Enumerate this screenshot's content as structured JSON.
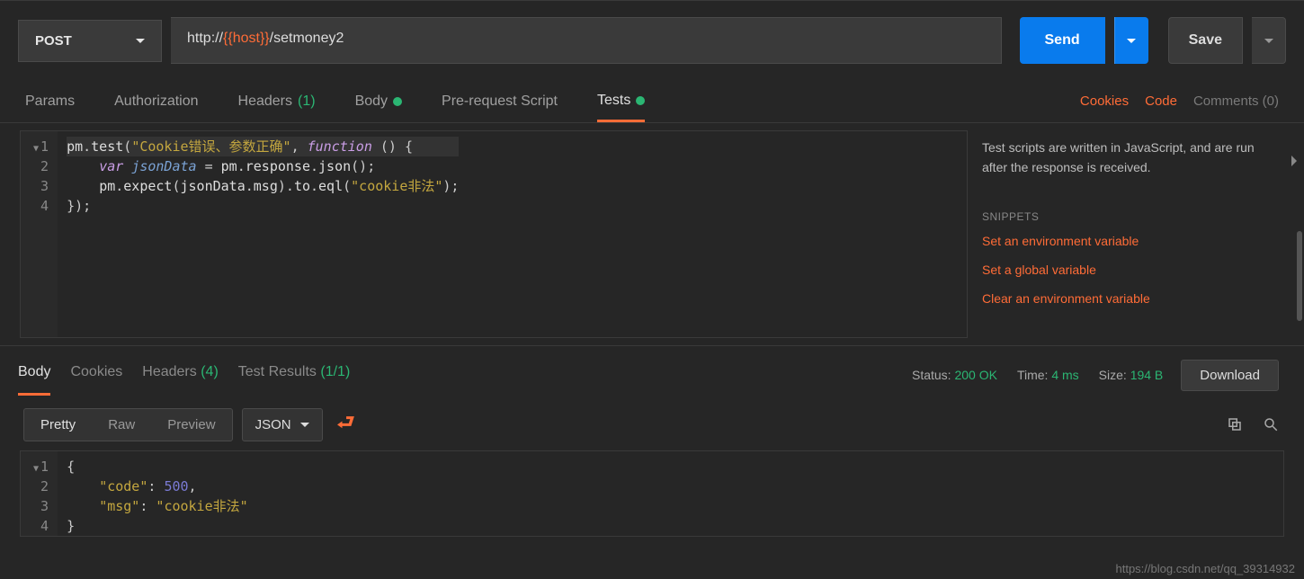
{
  "request": {
    "method": "POST",
    "url_prefix": "http://",
    "url_var": "{{host}}",
    "url_suffix": "/setmoney2",
    "send_label": "Send",
    "save_label": "Save"
  },
  "req_tabs": {
    "params": "Params",
    "authorization": "Authorization",
    "headers": "Headers",
    "headers_count": "(1)",
    "body": "Body",
    "prerequest": "Pre-request Script",
    "tests": "Tests"
  },
  "right_links": {
    "cookies": "Cookies",
    "code": "Code",
    "comments": "Comments (0)"
  },
  "test_script": {
    "lines": [
      "pm.test(\"Cookie错误、参数正确\", function () {",
      "    var jsonData = pm.response.json();",
      "    pm.expect(jsonData.msg).to.eql(\"cookie非法\");",
      "});"
    ]
  },
  "side": {
    "description": "Test scripts are written in JavaScript, and are run after the response is received.",
    "snippets_header": "SNIPPETS",
    "snippets": [
      "Set an environment variable",
      "Set a global variable",
      "Clear an environment variable"
    ]
  },
  "response": {
    "tabs": {
      "body": "Body",
      "cookies": "Cookies",
      "headers": "Headers",
      "headers_count": "(4)",
      "test_results": "Test Results",
      "test_results_count": "(1/1)"
    },
    "status_label": "Status:",
    "status_value": "200 OK",
    "time_label": "Time:",
    "time_value": "4 ms",
    "size_label": "Size:",
    "size_value": "194 B",
    "download": "Download",
    "view_modes": {
      "pretty": "Pretty",
      "raw": "Raw",
      "preview": "Preview"
    },
    "format": "JSON",
    "body_json": {
      "code": 500,
      "msg": "cookie非法"
    }
  },
  "watermark": "https://blog.csdn.net/qq_39314932"
}
